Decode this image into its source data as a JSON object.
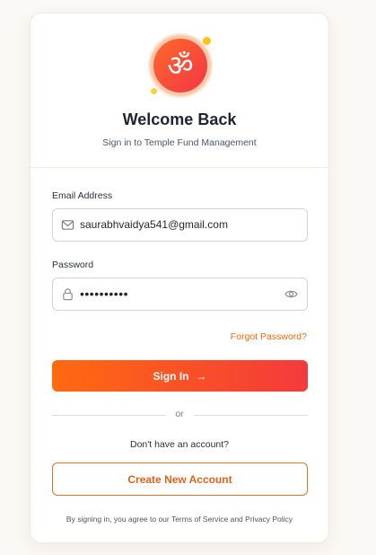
{
  "header": {
    "logo_symbol": "ॐ",
    "title": "Welcome Back",
    "subtitle": "Sign in to Temple Fund Management"
  },
  "form": {
    "email": {
      "label": "Email Address",
      "value": "saurabhvaidya541@gmail.com",
      "icon": "mail-icon"
    },
    "password": {
      "label": "Password",
      "value": "••••••••••",
      "icon": "lock-icon",
      "toggle_icon": "eye-icon"
    },
    "forgot_label": "Forgot Password?",
    "signin_label": "Sign In",
    "signin_arrow": "→"
  },
  "divider_text": "or",
  "signup": {
    "prompt": "Don't have an account?",
    "button_label": "Create New Account"
  },
  "terms": "By signing in, you agree to our Terms of Service and Privacy Policy",
  "colors": {
    "accent_orange": "#ff6a10",
    "accent_red": "#f43a3c",
    "link_orange": "#f06a10",
    "title_dark": "#1f2433"
  }
}
